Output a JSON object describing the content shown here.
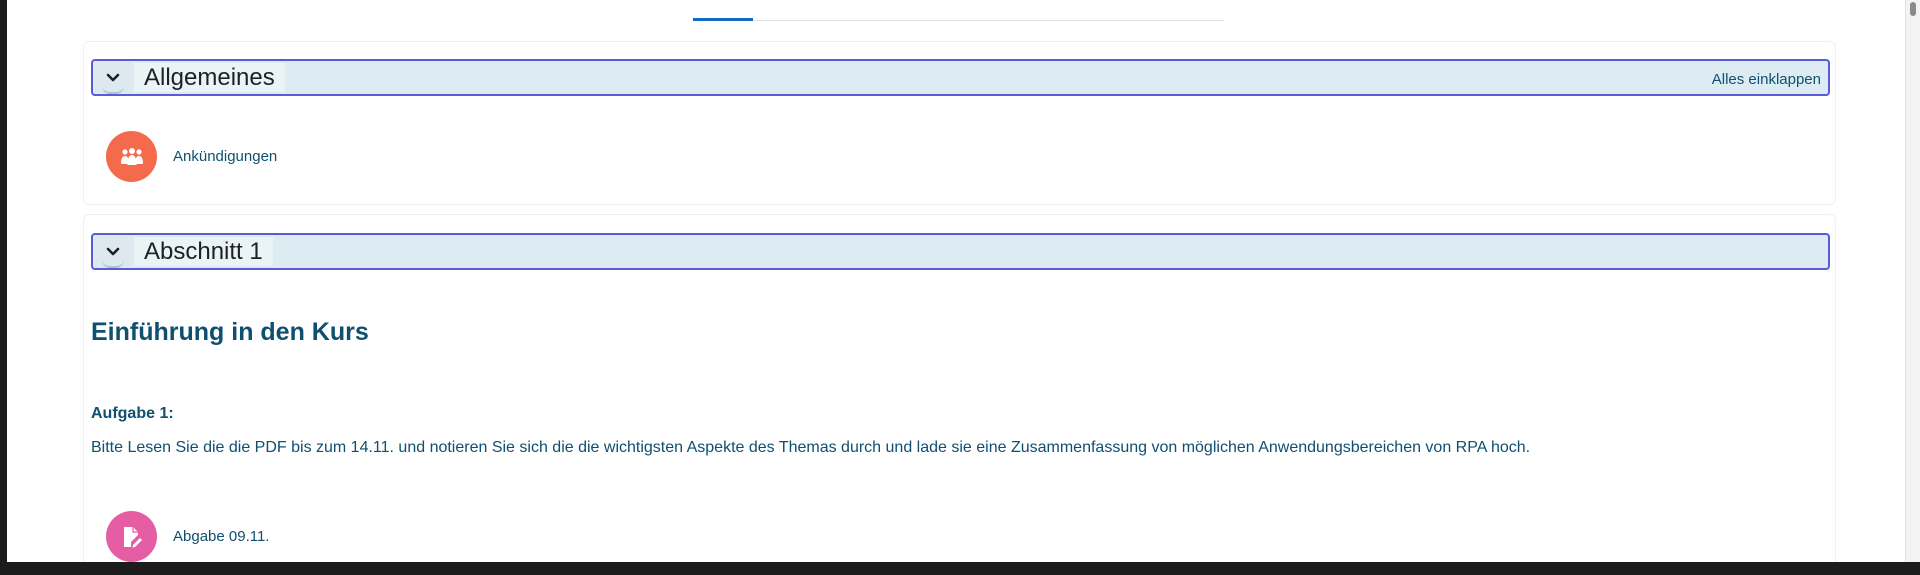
{
  "sections": [
    {
      "title": "Allgemeines",
      "collapse_all_label": "Alles einklappen",
      "activities": [
        {
          "name": "Ankündigungen",
          "icon": "forum-icon",
          "color": "#f36b4c"
        }
      ]
    },
    {
      "title": "Abschnitt 1",
      "heading": "Einführung in den Kurs",
      "task_label": "Aufgabe 1:",
      "task_text": "Bitte Lesen Sie die die PDF bis zum 14.11. und notieren Sie sich die die wichtigsten Aspekte des Themas durch und lade sie eine Zusammenfassung von möglichen Anwendungsbereichen von RPA hoch.",
      "activities": [
        {
          "name": "Abgabe 09.11.",
          "icon": "assignment-icon",
          "color": "#e55ea4"
        }
      ]
    }
  ],
  "colors": {
    "header_bg": "#dcecf2",
    "header_border": "#5b5bd6",
    "text_link": "#0f4f70",
    "tab_active": "#0f6cbf"
  }
}
